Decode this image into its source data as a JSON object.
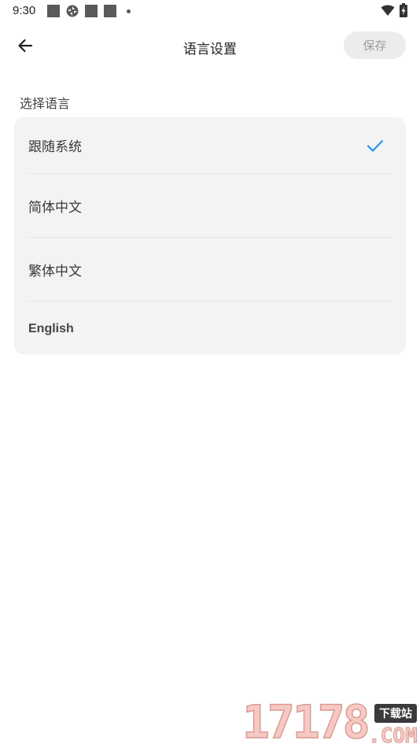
{
  "status_bar": {
    "time": "9:30",
    "icons": [
      "notification-square-icon",
      "sync-icon",
      "notification-square-icon",
      "notification-square-icon",
      "dot-icon",
      "wifi-icon",
      "battery-charging-icon"
    ]
  },
  "app_bar": {
    "back_icon": "arrow-left-icon",
    "title": "语言设置",
    "save_label": "保存"
  },
  "section": {
    "label": "选择语言"
  },
  "languages": [
    {
      "label": "跟随系统",
      "selected": true
    },
    {
      "label": "简体中文",
      "selected": false
    },
    {
      "label": "繁体中文",
      "selected": false
    },
    {
      "label": "English",
      "selected": false
    }
  ],
  "colors": {
    "accent": "#2196F3",
    "card_bg": "#F3F3F3",
    "save_disabled_bg": "#ECECEC",
    "save_disabled_text": "#9E9E9E"
  },
  "watermark": {
    "digits": "17178",
    "badge": "下载站",
    "domain": ".COM"
  }
}
